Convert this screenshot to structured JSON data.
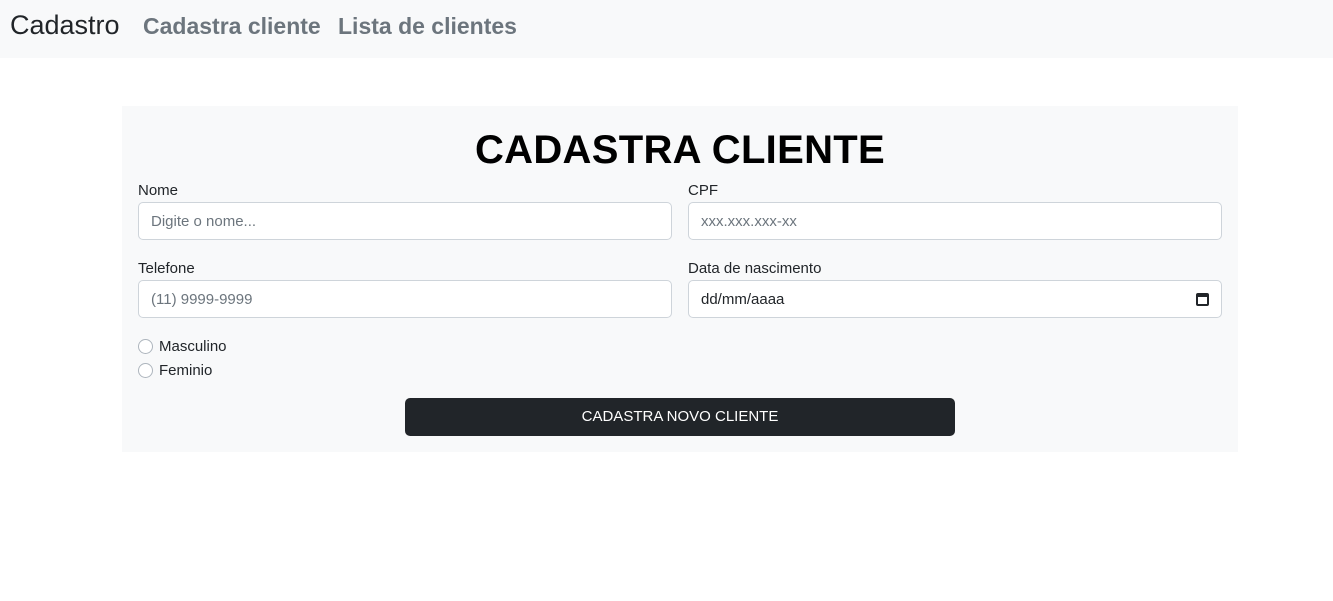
{
  "navbar": {
    "brand": "Cadastro",
    "links": [
      {
        "label": "Cadastra cliente"
      },
      {
        "label": "Lista de clientes"
      }
    ]
  },
  "form": {
    "title": "CADASTRA CLIENTE",
    "nome": {
      "label": "Nome",
      "placeholder": "Digite o nome...",
      "value": ""
    },
    "cpf": {
      "label": "CPF",
      "placeholder": "xxx.xxx.xxx-xx",
      "value": ""
    },
    "telefone": {
      "label": "Telefone",
      "placeholder": "(11) 9999-9999",
      "value": ""
    },
    "nascimento": {
      "label": "Data de nascimento",
      "placeholder": "dd/mm/aaaa"
    },
    "gender_options": [
      {
        "label": "Masculino",
        "checked": false
      },
      {
        "label": "Feminio",
        "checked": false
      }
    ],
    "submit_label": "CADASTRA NOVO CLIENTE"
  },
  "colors": {
    "navbar_bg": "#f8f9fa",
    "card_bg": "#f8f9fa",
    "button_bg": "#212529",
    "nav_link": "#6c757d"
  }
}
